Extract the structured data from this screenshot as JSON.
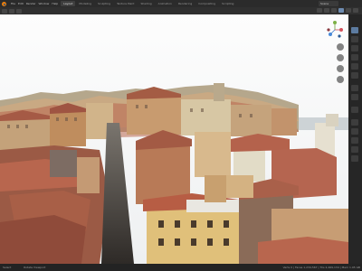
{
  "app": {
    "menu": [
      "File",
      "Edit",
      "Render",
      "Window",
      "Help"
    ]
  },
  "workspace_tabs": [
    {
      "label": "Layout",
      "active": true
    },
    {
      "label": "Modeling",
      "active": false
    },
    {
      "label": "Sculpting",
      "active": false
    },
    {
      "label": "Texture Paint",
      "active": false
    },
    {
      "label": "Shading",
      "active": false
    },
    {
      "label": "Animation",
      "active": false
    },
    {
      "label": "Rendering",
      "active": false
    },
    {
      "label": "Compositing",
      "active": false
    },
    {
      "label": "Scripting",
      "active": false
    }
  ],
  "scene": {
    "name": "Scene"
  },
  "colors": {
    "sky": "#ffffff",
    "sea": "#cdd3d6",
    "roof": "#b8664e",
    "wall": "#d6c59b",
    "ui_bg": "#1d1d1d"
  },
  "status": {
    "left": "Select",
    "middle": "Rotate Viewport",
    "right": "Verts 0 | Faces 1,234,567 | Tris 2,469,134 | Mem 1.95 GB"
  }
}
